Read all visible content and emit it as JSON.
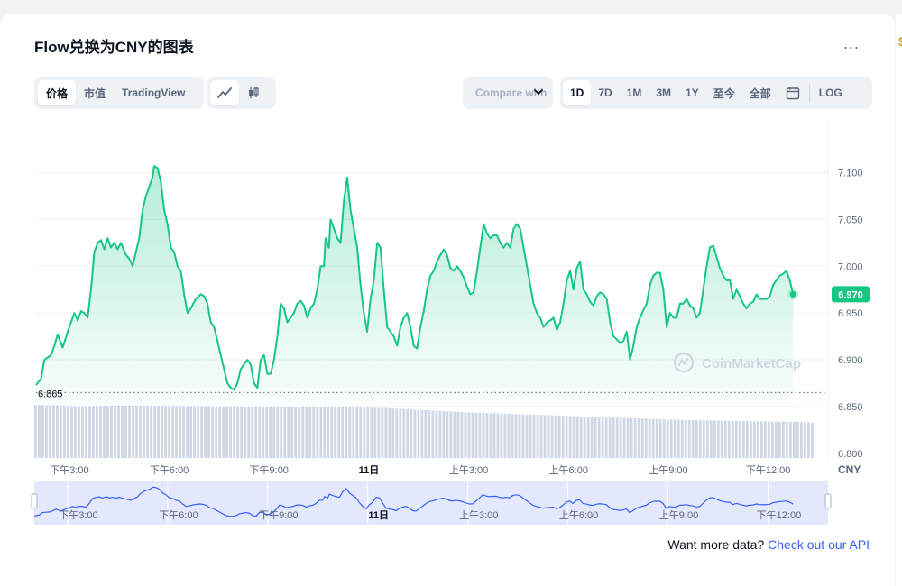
{
  "title": "Flow兑换为CNY的图表",
  "more_label": "...",
  "right_edge_glyph": "$",
  "type_tabs": [
    {
      "label": "价格",
      "active": true
    },
    {
      "label": "市值",
      "active": false
    },
    {
      "label": "TradingView",
      "active": false
    }
  ],
  "chart_type_icons": [
    {
      "icon": "line-chart-icon",
      "active": true
    },
    {
      "icon": "candlestick-icon",
      "active": false
    }
  ],
  "compare": {
    "label": "Compare with"
  },
  "ranges": [
    {
      "label": "1D",
      "active": true
    },
    {
      "label": "7D",
      "active": false
    },
    {
      "label": "1M",
      "active": false
    },
    {
      "label": "3M",
      "active": false
    },
    {
      "label": "1Y",
      "active": false
    },
    {
      "label": "至今",
      "active": false
    },
    {
      "label": "全部",
      "active": false
    }
  ],
  "calendar_icon": "calendar-icon",
  "log_label": "LOG",
  "watermark": "CoinMarketCap",
  "footer": {
    "text": "Want more data?",
    "link": "Check out our API"
  },
  "colors": {
    "line": "#16c784",
    "grid": "#eff2f5",
    "volume": "#cfd6e4",
    "nav_line": "#3861fb",
    "nav_fill": "#e3e8fd"
  },
  "chart_data": {
    "type": "area",
    "currency_label": "CNY",
    "y_ticks": [
      6.8,
      6.85,
      6.9,
      6.95,
      7.0,
      7.05,
      7.1
    ],
    "y_tick_labels": [
      "6.800",
      "6.850",
      "6.900",
      "6.950",
      "7.000",
      "7.050",
      "7.100"
    ],
    "ylim": [
      6.795,
      7.14
    ],
    "x_labels": [
      "下午3:00",
      "下午6:00",
      "下午9:00",
      "11日",
      "上午3:00",
      "上午6:00",
      "上午9:00",
      "下午12:00"
    ],
    "x_hours": [
      1,
      4,
      7,
      10,
      13,
      16,
      19,
      22
    ],
    "x_range_hours": [
      0,
      23.8
    ],
    "baseline": 6.865,
    "baseline_label": "6.865",
    "current": 6.97,
    "current_label": "6.970",
    "grid": true,
    "series": [
      {
        "values": [
          [
            0.0,
            6.873
          ],
          [
            0.15,
            6.88
          ],
          [
            0.25,
            6.9
          ],
          [
            0.45,
            6.905
          ],
          [
            0.55,
            6.915
          ],
          [
            0.65,
            6.927
          ],
          [
            0.8,
            6.913
          ],
          [
            0.95,
            6.93
          ],
          [
            1.05,
            6.94
          ],
          [
            1.15,
            6.95
          ],
          [
            1.25,
            6.942
          ],
          [
            1.35,
            6.952
          ],
          [
            1.45,
            6.95
          ],
          [
            1.55,
            6.945
          ],
          [
            1.65,
            6.975
          ],
          [
            1.75,
            7.015
          ],
          [
            1.85,
            7.025
          ],
          [
            1.95,
            7.028
          ],
          [
            2.05,
            7.018
          ],
          [
            2.15,
            7.03
          ],
          [
            2.25,
            7.02
          ],
          [
            2.35,
            7.025
          ],
          [
            2.45,
            7.018
          ],
          [
            2.55,
            7.025
          ],
          [
            2.7,
            7.012
          ],
          [
            2.8,
            7.008
          ],
          [
            2.9,
            7.0
          ],
          [
            3.0,
            7.015
          ],
          [
            3.1,
            7.03
          ],
          [
            3.2,
            7.06
          ],
          [
            3.3,
            7.075
          ],
          [
            3.4,
            7.085
          ],
          [
            3.5,
            7.095
          ],
          [
            3.55,
            7.107
          ],
          [
            3.65,
            7.105
          ],
          [
            3.75,
            7.09
          ],
          [
            3.85,
            7.06
          ],
          [
            3.95,
            7.045
          ],
          [
            4.05,
            7.02
          ],
          [
            4.15,
            7.015
          ],
          [
            4.25,
            7.0
          ],
          [
            4.35,
            6.995
          ],
          [
            4.45,
            6.97
          ],
          [
            4.55,
            6.95
          ],
          [
            4.65,
            6.955
          ],
          [
            4.8,
            6.965
          ],
          [
            4.95,
            6.97
          ],
          [
            5.05,
            6.968
          ],
          [
            5.15,
            6.96
          ],
          [
            5.25,
            6.94
          ],
          [
            5.35,
            6.935
          ],
          [
            5.45,
            6.92
          ],
          [
            5.55,
            6.905
          ],
          [
            5.65,
            6.89
          ],
          [
            5.75,
            6.875
          ],
          [
            5.85,
            6.87
          ],
          [
            5.95,
            6.868
          ],
          [
            6.05,
            6.875
          ],
          [
            6.15,
            6.89
          ],
          [
            6.25,
            6.895
          ],
          [
            6.35,
            6.9
          ],
          [
            6.45,
            6.895
          ],
          [
            6.55,
            6.875
          ],
          [
            6.65,
            6.87
          ],
          [
            6.75,
            6.9
          ],
          [
            6.85,
            6.905
          ],
          [
            6.95,
            6.885
          ],
          [
            7.05,
            6.885
          ],
          [
            7.15,
            6.9
          ],
          [
            7.25,
            6.925
          ],
          [
            7.35,
            6.96
          ],
          [
            7.45,
            6.955
          ],
          [
            7.55,
            6.94
          ],
          [
            7.65,
            6.945
          ],
          [
            7.75,
            6.95
          ],
          [
            7.85,
            6.96
          ],
          [
            7.95,
            6.963
          ],
          [
            8.05,
            6.958
          ],
          [
            8.15,
            6.945
          ],
          [
            8.25,
            6.955
          ],
          [
            8.35,
            6.96
          ],
          [
            8.45,
            6.975
          ],
          [
            8.55,
            7.0
          ],
          [
            8.65,
            7.0
          ],
          [
            8.7,
            7.03
          ],
          [
            8.8,
            7.02
          ],
          [
            8.85,
            7.05
          ],
          [
            8.95,
            7.04
          ],
          [
            9.05,
            7.03
          ],
          [
            9.15,
            7.025
          ],
          [
            9.25,
            7.07
          ],
          [
            9.35,
            7.095
          ],
          [
            9.45,
            7.06
          ],
          [
            9.55,
            7.04
          ],
          [
            9.65,
            7.02
          ],
          [
            9.75,
            6.98
          ],
          [
            9.85,
            6.95
          ],
          [
            9.95,
            6.93
          ],
          [
            10.05,
            6.965
          ],
          [
            10.15,
            6.985
          ],
          [
            10.25,
            7.025
          ],
          [
            10.35,
            7.02
          ],
          [
            10.45,
            6.975
          ],
          [
            10.55,
            6.935
          ],
          [
            10.65,
            6.93
          ],
          [
            10.75,
            6.925
          ],
          [
            10.85,
            6.915
          ],
          [
            10.95,
            6.935
          ],
          [
            11.05,
            6.945
          ],
          [
            11.15,
            6.95
          ],
          [
            11.25,
            6.935
          ],
          [
            11.35,
            6.915
          ],
          [
            11.45,
            6.912
          ],
          [
            11.55,
            6.935
          ],
          [
            11.65,
            6.952
          ],
          [
            11.75,
            6.975
          ],
          [
            11.85,
            6.99
          ],
          [
            11.95,
            6.995
          ],
          [
            12.05,
            7.005
          ],
          [
            12.15,
            7.012
          ],
          [
            12.25,
            7.018
          ],
          [
            12.35,
            7.012
          ],
          [
            12.45,
            6.998
          ],
          [
            12.55,
            6.995
          ],
          [
            12.65,
            7.0
          ],
          [
            12.75,
            6.995
          ],
          [
            12.85,
            6.988
          ],
          [
            12.95,
            6.978
          ],
          [
            13.05,
            6.97
          ],
          [
            13.15,
            6.972
          ],
          [
            13.25,
            6.995
          ],
          [
            13.35,
            7.02
          ],
          [
            13.45,
            7.045
          ],
          [
            13.55,
            7.035
          ],
          [
            13.65,
            7.03
          ],
          [
            13.75,
            7.033
          ],
          [
            13.85,
            7.033
          ],
          [
            13.95,
            7.025
          ],
          [
            14.05,
            7.02
          ],
          [
            14.15,
            7.025
          ],
          [
            14.25,
            7.02
          ],
          [
            14.35,
            7.04
          ],
          [
            14.45,
            7.045
          ],
          [
            14.55,
            7.04
          ],
          [
            14.65,
            7.02
          ],
          [
            14.75,
            7.0
          ],
          [
            14.85,
            6.98
          ],
          [
            14.95,
            6.96
          ],
          [
            15.05,
            6.95
          ],
          [
            15.15,
            6.945
          ],
          [
            15.25,
            6.935
          ],
          [
            15.35,
            6.94
          ],
          [
            15.45,
            6.942
          ],
          [
            15.55,
            6.945
          ],
          [
            15.65,
            6.932
          ],
          [
            15.75,
            6.94
          ],
          [
            15.85,
            6.96
          ],
          [
            15.95,
            6.985
          ],
          [
            16.05,
            6.995
          ],
          [
            16.15,
            6.975
          ],
          [
            16.25,
            6.998
          ],
          [
            16.35,
            7.005
          ],
          [
            16.45,
            6.975
          ],
          [
            16.55,
            6.97
          ],
          [
            16.65,
            6.962
          ],
          [
            16.75,
            6.958
          ],
          [
            16.85,
            6.968
          ],
          [
            16.95,
            6.972
          ],
          [
            17.05,
            6.97
          ],
          [
            17.15,
            6.965
          ],
          [
            17.25,
            6.94
          ],
          [
            17.35,
            6.925
          ],
          [
            17.45,
            6.922
          ],
          [
            17.55,
            6.918
          ],
          [
            17.65,
            6.92
          ],
          [
            17.75,
            6.93
          ],
          [
            17.85,
            6.9
          ],
          [
            17.95,
            6.915
          ],
          [
            18.05,
            6.935
          ],
          [
            18.15,
            6.945
          ],
          [
            18.25,
            6.953
          ],
          [
            18.35,
            6.96
          ],
          [
            18.45,
            6.98
          ],
          [
            18.55,
            6.99
          ],
          [
            18.65,
            6.993
          ],
          [
            18.75,
            6.993
          ],
          [
            18.85,
            6.975
          ],
          [
            18.95,
            6.935
          ],
          [
            19.05,
            6.95
          ],
          [
            19.15,
            6.945
          ],
          [
            19.25,
            6.945
          ],
          [
            19.35,
            6.96
          ],
          [
            19.45,
            6.96
          ],
          [
            19.55,
            6.965
          ],
          [
            19.65,
            6.958
          ],
          [
            19.75,
            6.955
          ],
          [
            19.85,
            6.945
          ],
          [
            19.95,
            6.95
          ],
          [
            20.05,
            6.975
          ],
          [
            20.15,
            7.0
          ],
          [
            20.25,
            7.02
          ],
          [
            20.35,
            7.022
          ],
          [
            20.45,
            7.01
          ],
          [
            20.55,
            6.998
          ],
          [
            20.65,
            6.99
          ],
          [
            20.75,
            6.985
          ],
          [
            20.85,
            6.985
          ],
          [
            20.95,
            6.965
          ],
          [
            21.05,
            6.975
          ],
          [
            21.15,
            6.968
          ],
          [
            21.25,
            6.96
          ],
          [
            21.35,
            6.955
          ],
          [
            21.45,
            6.96
          ],
          [
            21.55,
            6.962
          ],
          [
            21.65,
            6.97
          ],
          [
            21.75,
            6.965
          ],
          [
            21.85,
            6.965
          ],
          [
            21.95,
            6.965
          ],
          [
            22.05,
            6.968
          ],
          [
            22.15,
            6.98
          ],
          [
            22.25,
            6.985
          ],
          [
            22.35,
            6.99
          ],
          [
            22.45,
            6.992
          ],
          [
            22.55,
            6.995
          ],
          [
            22.65,
            6.985
          ],
          [
            22.75,
            6.97
          ]
        ]
      }
    ],
    "volume": {
      "bars": 216,
      "segments": [
        [
          0,
          0.7
        ],
        [
          12,
          0.68
        ],
        [
          24,
          0.69
        ],
        [
          48,
          0.68
        ],
        [
          96,
          0.66
        ],
        [
          120,
          0.6
        ],
        [
          156,
          0.54
        ],
        [
          180,
          0.5
        ],
        [
          215,
          0.47
        ]
      ]
    }
  }
}
